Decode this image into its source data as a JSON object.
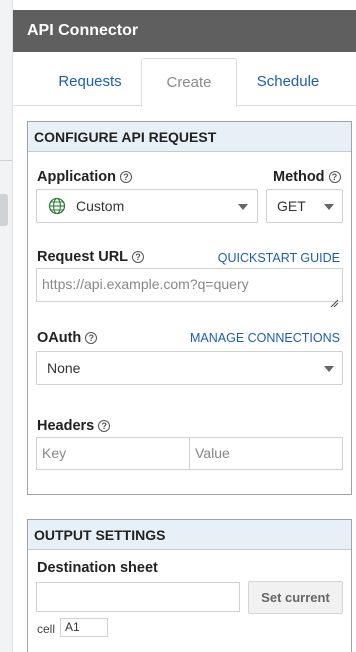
{
  "app": {
    "title": "API Connector"
  },
  "tabs": [
    {
      "label": "Requests",
      "active": false
    },
    {
      "label": "Create",
      "active": true
    },
    {
      "label": "Schedule",
      "active": false
    }
  ],
  "configure": {
    "header": "CONFIGURE API REQUEST",
    "application": {
      "label": "Application",
      "value": "Custom",
      "icon": "globe-icon"
    },
    "method": {
      "label": "Method",
      "value": "GET"
    },
    "request_url": {
      "label": "Request URL",
      "link": "QUICKSTART GUIDE",
      "placeholder": "https://api.example.com?q=query"
    },
    "oauth": {
      "label": "OAuth",
      "link": "MANAGE CONNECTIONS",
      "value": "None"
    },
    "headers": {
      "label": "Headers",
      "key_placeholder": "Key",
      "value_placeholder": "Value"
    }
  },
  "output": {
    "header": "OUTPUT SETTINGS",
    "destination_label": "Destination sheet",
    "set_current": "Set current",
    "cell_label": "cell",
    "cell_value": "A1"
  },
  "colors": {
    "title_bar": "#5f5f5f",
    "link": "#1a5fb4",
    "section_header": "#e8f0f7"
  }
}
